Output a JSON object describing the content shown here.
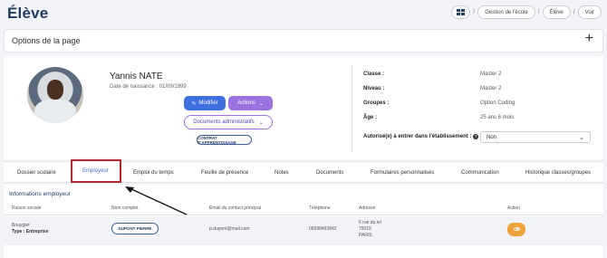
{
  "page_title": "Élève",
  "breadcrumb": {
    "items": [
      "Gestion de l'école",
      "Élève",
      "Voir"
    ],
    "separator": "/"
  },
  "options": {
    "label": "Options de la page",
    "add_symbol": "+"
  },
  "student": {
    "name": "Yannis NATE",
    "dob": "Date de naissance : 01/09/1999"
  },
  "buttons": {
    "modifier": "Modifier",
    "actions": "Actions",
    "documents": "Documents administratifs",
    "contrat": "CONTRAT D'APPRENTISSAGE"
  },
  "info": {
    "classe_label": "Classe :",
    "classe_value": "Master 2",
    "niveau_label": "Niveau :",
    "niveau_value": "Master 2",
    "groupes_label": "Groupes :",
    "groupes_value": "Option Coding",
    "age_label": "Âge :",
    "age_value": "25 ans 6 mois",
    "autorise_label": "Autorisé(e) à entrer dans l'établissement :",
    "autorise_value": "Non"
  },
  "tabs": [
    "Dossier scolaire",
    "Employeur",
    "Emploi du temps",
    "Feuille de présence",
    "Notes",
    "Documents",
    "Formulaires personnalisés",
    "Communication",
    "Historique classes/groupes"
  ],
  "employer": {
    "section_title": "Informations employeur",
    "columns": [
      "Raison sociale",
      "Nom complet",
      "Email du contact principal",
      "Téléphone",
      "Adresse",
      "Action"
    ],
    "row": {
      "company": "Bouygtel",
      "type": "Type : Entreprise",
      "contact_button": "DUPONT PIERRE",
      "email": "p.dupont@mail.com",
      "phone": "06598493842",
      "address_line1": "6 rue du lel",
      "address_line2": "75015",
      "address_line3": "PARIS"
    }
  },
  "colors": {
    "accent": "#3f6fe0",
    "purple": "#9b73e0",
    "highlight": "#b3282d",
    "action": "#f0a23a"
  }
}
